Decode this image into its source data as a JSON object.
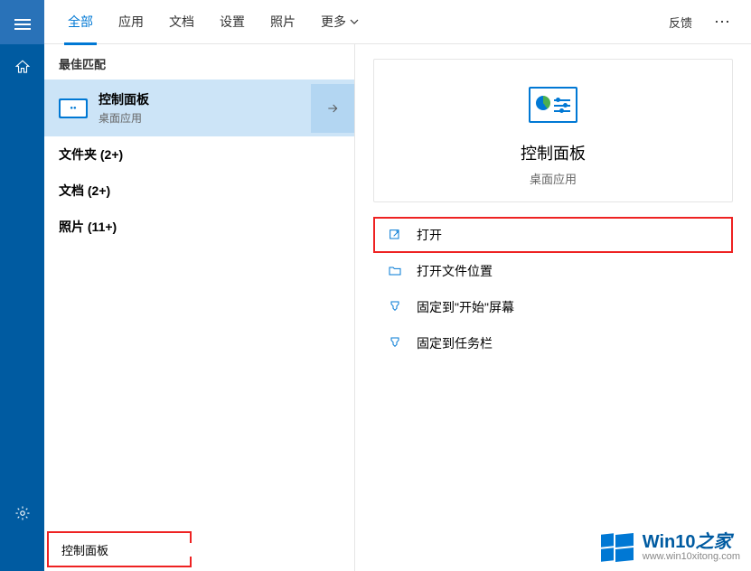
{
  "tabs": {
    "items": [
      "全部",
      "应用",
      "文档",
      "设置",
      "照片",
      "更多"
    ],
    "active_index": 0,
    "feedback": "反馈",
    "more_dots": "⋯"
  },
  "results": {
    "best_match_header": "最佳匹配",
    "best_match": {
      "title": "控制面板",
      "subtitle": "桌面应用"
    },
    "categories": [
      "文件夹 (2+)",
      "文档 (2+)",
      "照片 (11+)"
    ]
  },
  "detail": {
    "title": "控制面板",
    "subtitle": "桌面应用",
    "actions": [
      {
        "label": "打开",
        "icon": "open",
        "highlighted": true
      },
      {
        "label": "打开文件位置",
        "icon": "folder",
        "highlighted": false
      },
      {
        "label": "固定到\"开始\"屏幕",
        "icon": "pin-start",
        "highlighted": false
      },
      {
        "label": "固定到任务栏",
        "icon": "pin-taskbar",
        "highlighted": false
      }
    ]
  },
  "search": {
    "value": "控制面板"
  },
  "watermark": {
    "title_main": "Win10",
    "title_accent": "之家",
    "url": "www.win10xitong.com"
  }
}
